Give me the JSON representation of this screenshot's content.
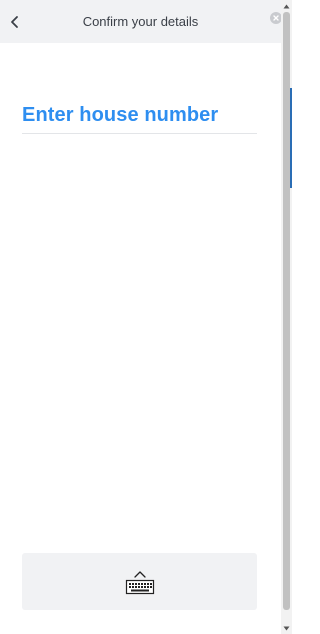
{
  "header": {
    "title": "Confirm your details",
    "back_icon": "chevron-left-icon",
    "close_icon": "close-icon"
  },
  "main": {
    "prompt": "Enter house number"
  },
  "keyboard_button": {
    "icon": "keyboard-icon"
  },
  "colors": {
    "accent": "#2e8ef0",
    "header_bg": "#f1f2f4",
    "title_text": "#3a3f47"
  }
}
